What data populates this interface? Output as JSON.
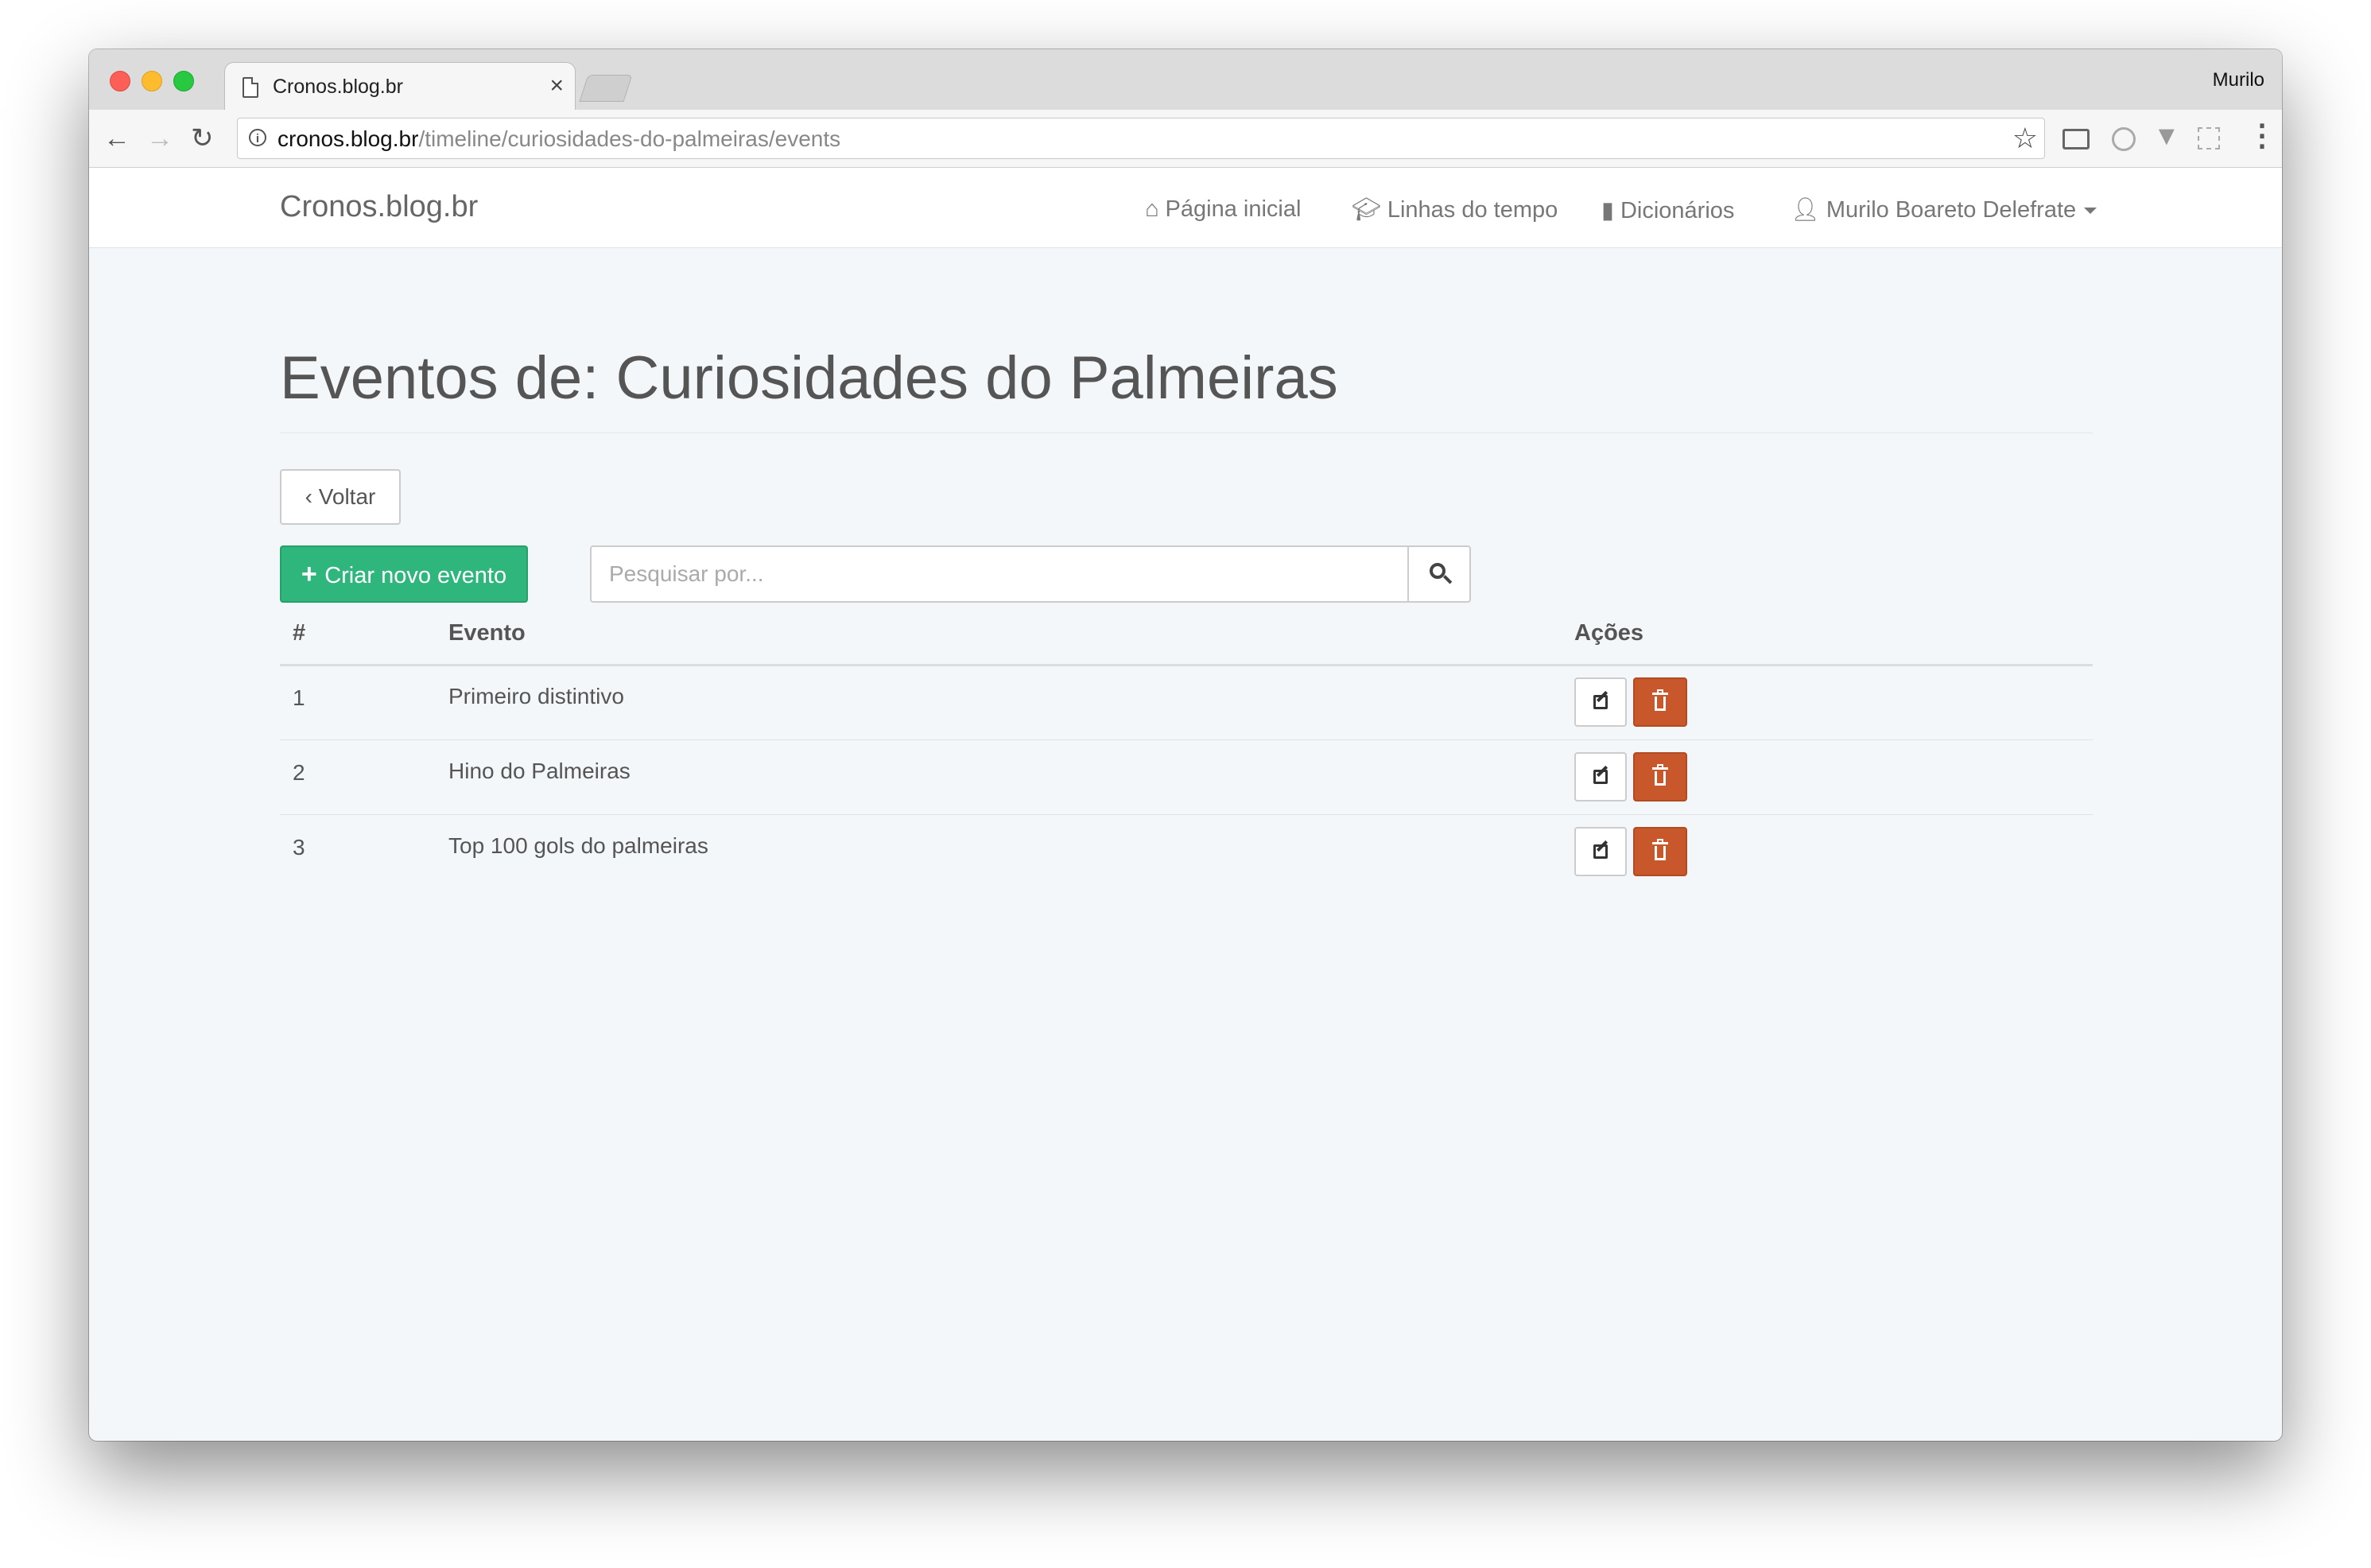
{
  "browser": {
    "tab_title": "Cronos.blog.br",
    "tab_close": "×",
    "profile_name": "Murilo",
    "url_host": "cronos.blog.br",
    "url_path": "/timeline/curiosidades-do-palmeiras/events"
  },
  "navbar": {
    "brand": "Cronos.blog.br",
    "items": [
      {
        "label": "Página inicial",
        "icon": "home-icon"
      },
      {
        "label": "Linhas do tempo",
        "icon": "graduation-cap-icon"
      },
      {
        "label": "Dicionários",
        "icon": "book-icon"
      },
      {
        "label": "Murilo Boareto Delefrate",
        "icon": "user-icon"
      }
    ]
  },
  "page": {
    "title": "Eventos de: Curiosidades do Palmeiras",
    "back_label": "Voltar",
    "create_label": "Criar novo evento",
    "search_placeholder": "Pesquisar por..."
  },
  "table": {
    "headers": {
      "number": "#",
      "event": "Evento",
      "actions": "Ações"
    },
    "rows": [
      {
        "number": "1",
        "event": "Primeiro distintivo"
      },
      {
        "number": "2",
        "event": "Hino do Palmeiras"
      },
      {
        "number": "3",
        "event": "Top 100 gols do palmeiras"
      }
    ]
  },
  "colors": {
    "create_button": "#2fb67c",
    "delete_button": "#c9572c",
    "page_background": "#f4f7fa"
  }
}
